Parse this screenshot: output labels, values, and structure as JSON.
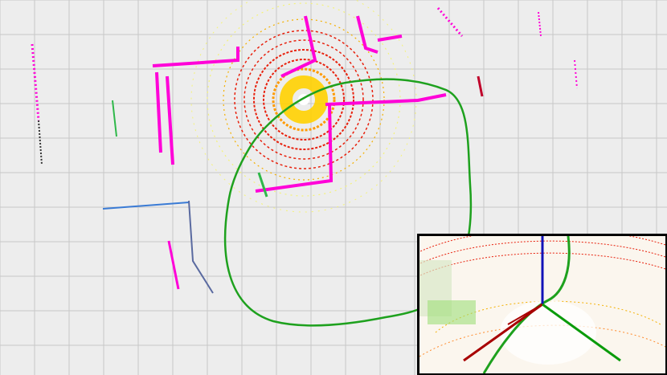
{
  "view": {
    "background": "#ededed",
    "grid_color": "#c8c8c8"
  },
  "map": {
    "wall_color": "#ff00d8",
    "scan_colors": [
      "#e8200c",
      "#ff7a00",
      "#ffd000",
      "#f4f27a"
    ],
    "trajectory_color": "#1ea11e",
    "sensor_origin_color": "#ffffff"
  },
  "inset": {
    "border_color": "#000000",
    "axis_colors": {
      "x": "#a80000",
      "y": "#0a9b0a",
      "z": "#1212b8"
    }
  }
}
